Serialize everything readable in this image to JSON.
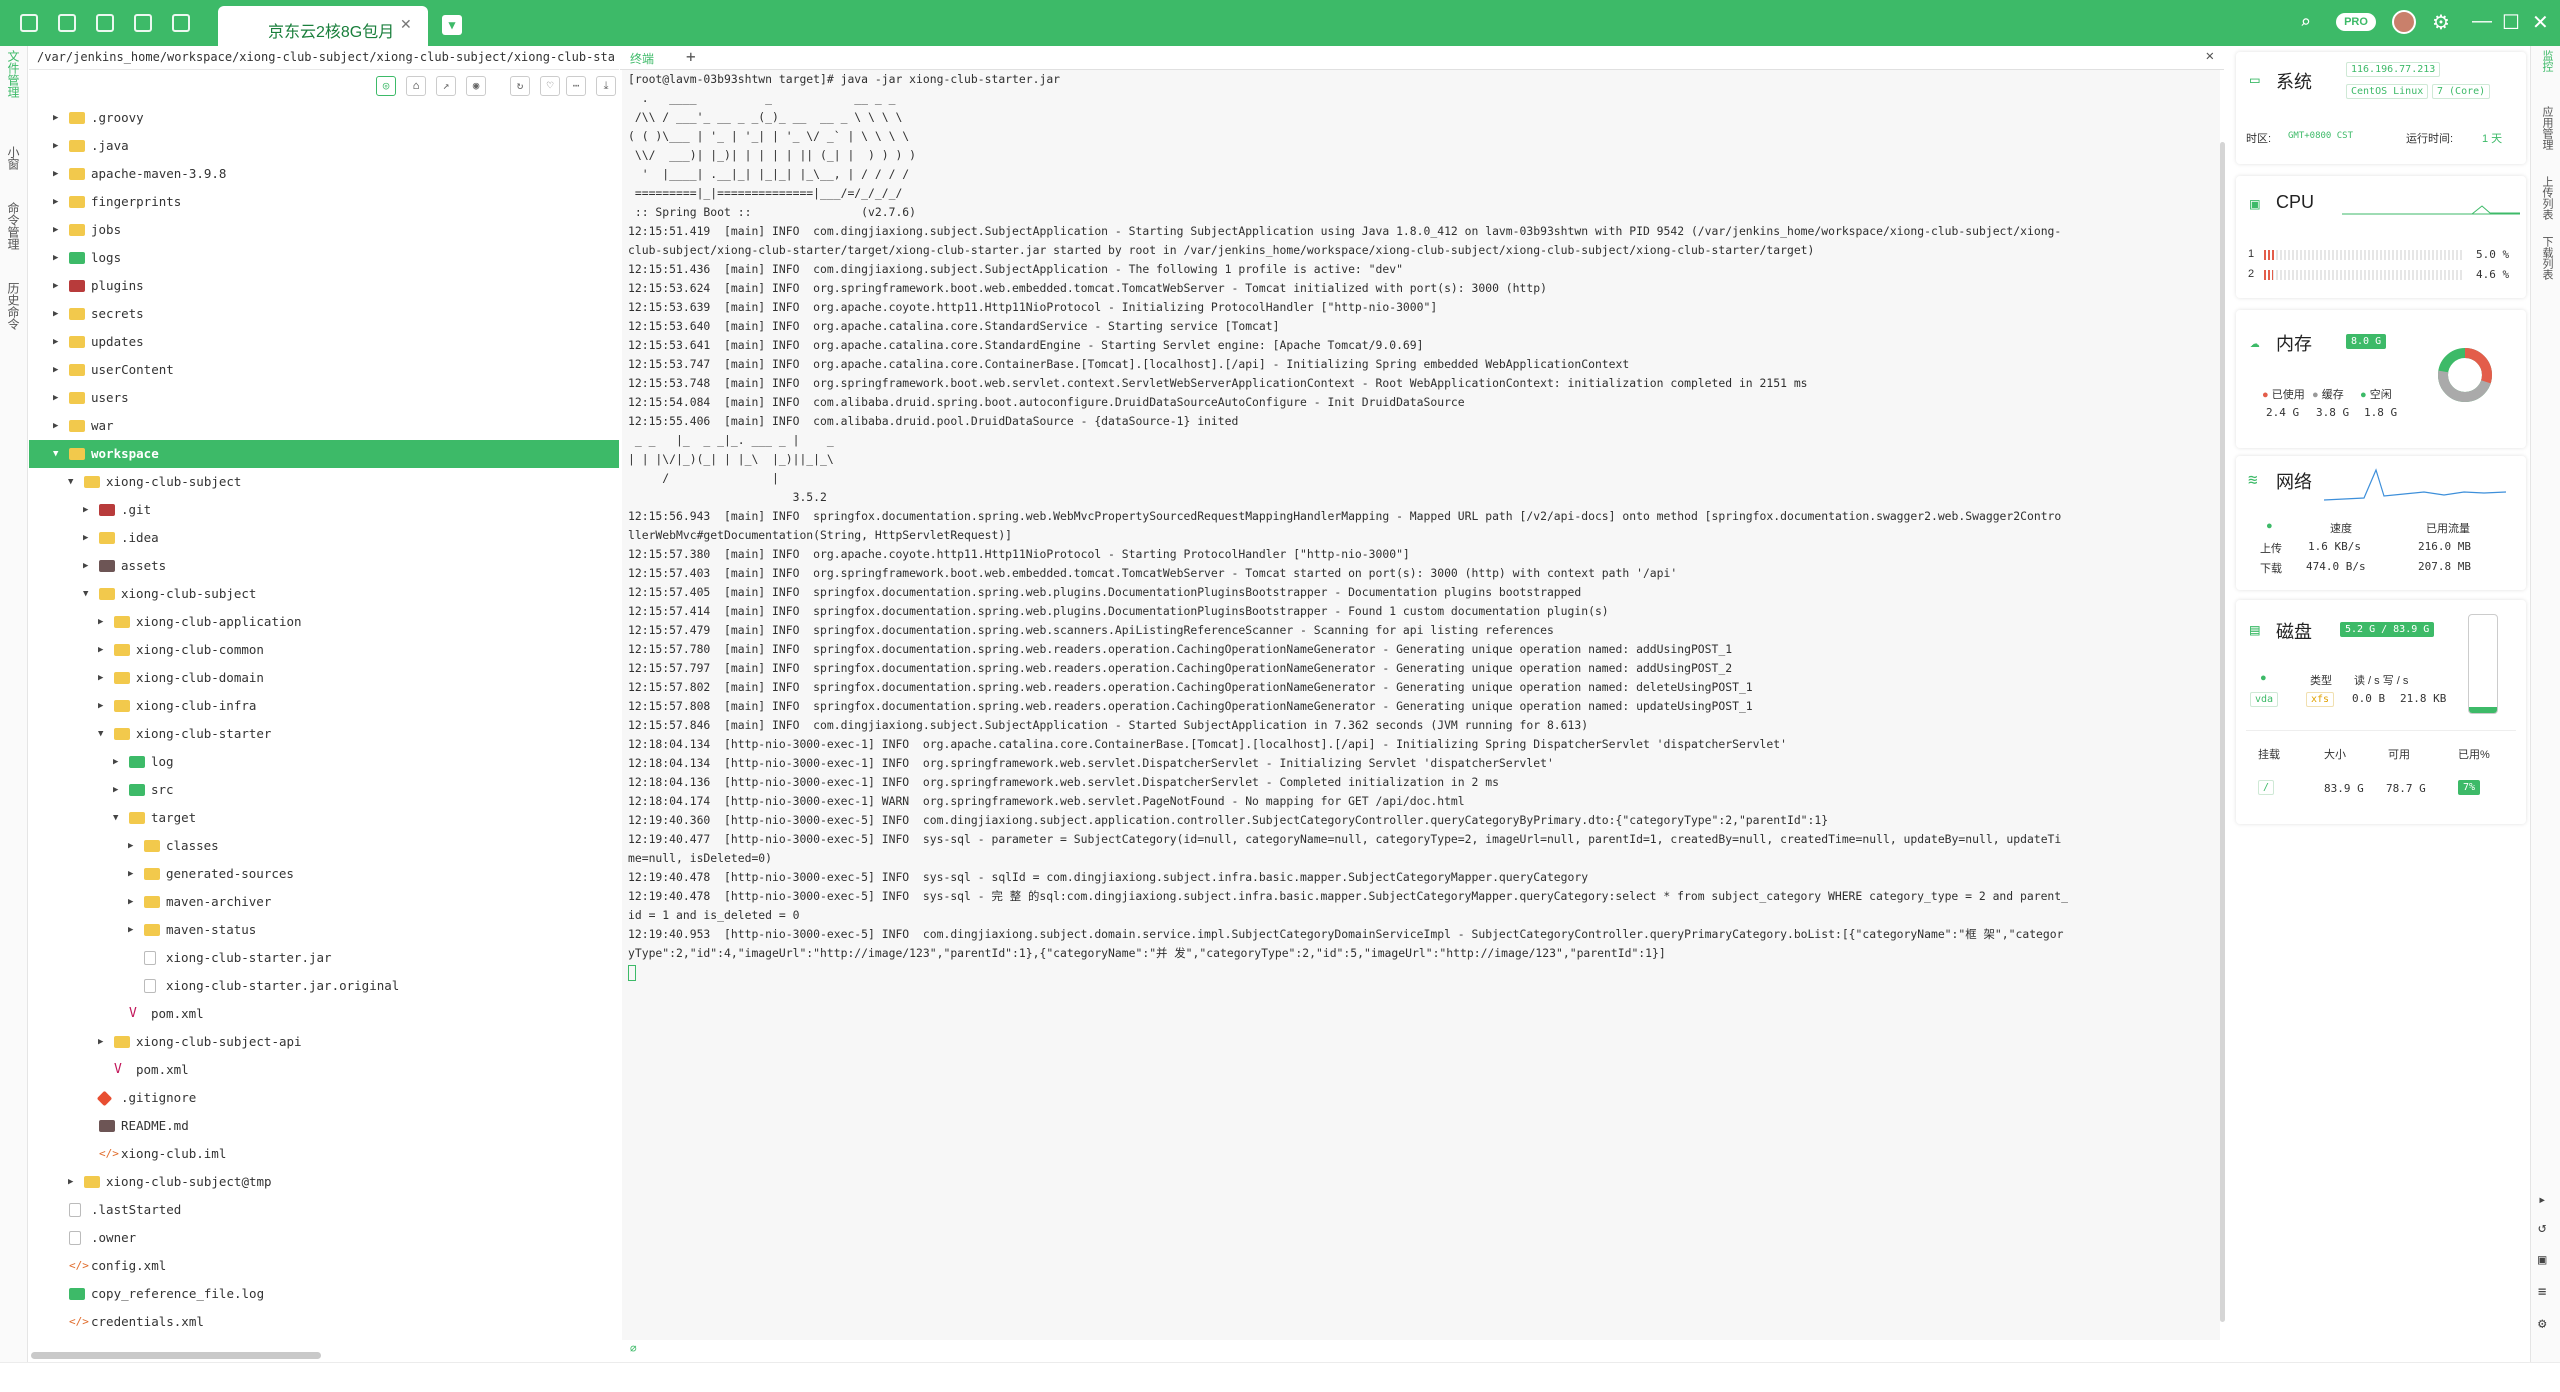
{
  "tabbar": {
    "active_tab": "京东云2核8G包月"
  },
  "leftbar": {
    "items": [
      "文件管理",
      "小窗",
      "命令管理",
      "历史命令"
    ]
  },
  "filetree": {
    "path": "/var/jenkins_home/workspace/xiong-club-subject/xiong-club-subject/xiong-club-sta",
    "rows": [
      {
        "label": ".groovy",
        "indent": 0,
        "caret": "right",
        "icon": "folder"
      },
      {
        "label": ".java",
        "indent": 0,
        "caret": "right",
        "icon": "folder"
      },
      {
        "label": "apache-maven-3.9.8",
        "indent": 0,
        "caret": "right",
        "icon": "folder"
      },
      {
        "label": "fingerprints",
        "indent": 0,
        "caret": "right",
        "icon": "folder"
      },
      {
        "label": "jobs",
        "indent": 0,
        "caret": "right",
        "icon": "folder"
      },
      {
        "label": "logs",
        "indent": 0,
        "caret": "right",
        "icon": "green"
      },
      {
        "label": "plugins",
        "indent": 0,
        "caret": "right",
        "icon": "red"
      },
      {
        "label": "secrets",
        "indent": 0,
        "caret": "right",
        "icon": "folder"
      },
      {
        "label": "updates",
        "indent": 0,
        "caret": "right",
        "icon": "folder"
      },
      {
        "label": "userContent",
        "indent": 0,
        "caret": "right",
        "icon": "folder"
      },
      {
        "label": "users",
        "indent": 0,
        "caret": "right",
        "icon": "folder"
      },
      {
        "label": "war",
        "indent": 0,
        "caret": "right",
        "icon": "folder"
      },
      {
        "label": "workspace",
        "indent": 0,
        "caret": "down",
        "icon": "folder",
        "selected": true
      },
      {
        "label": "xiong-club-subject",
        "indent": 1,
        "caret": "down",
        "icon": "folder"
      },
      {
        "label": ".git",
        "indent": 2,
        "caret": "right",
        "icon": "red"
      },
      {
        "label": ".idea",
        "indent": 2,
        "caret": "right",
        "icon": "folder"
      },
      {
        "label": "assets",
        "indent": 2,
        "caret": "right",
        "icon": "dark"
      },
      {
        "label": "xiong-club-subject",
        "indent": 2,
        "caret": "down",
        "icon": "folder"
      },
      {
        "label": "xiong-club-application",
        "indent": 3,
        "caret": "right",
        "icon": "folder"
      },
      {
        "label": "xiong-club-common",
        "indent": 3,
        "caret": "right",
        "icon": "folder"
      },
      {
        "label": "xiong-club-domain",
        "indent": 3,
        "caret": "right",
        "icon": "folder"
      },
      {
        "label": "xiong-club-infra",
        "indent": 3,
        "caret": "right",
        "icon": "folder"
      },
      {
        "label": "xiong-club-starter",
        "indent": 3,
        "caret": "down",
        "icon": "folder"
      },
      {
        "label": "log",
        "indent": 4,
        "caret": "right",
        "icon": "green"
      },
      {
        "label": "src",
        "indent": 4,
        "caret": "right",
        "icon": "green"
      },
      {
        "label": "target",
        "indent": 4,
        "caret": "down",
        "icon": "folder"
      },
      {
        "label": "classes",
        "indent": 5,
        "caret": "right",
        "icon": "folder"
      },
      {
        "label": "generated-sources",
        "indent": 5,
        "caret": "right",
        "icon": "folder"
      },
      {
        "label": "maven-archiver",
        "indent": 5,
        "caret": "right",
        "icon": "folder"
      },
      {
        "label": "maven-status",
        "indent": 5,
        "caret": "right",
        "icon": "folder"
      },
      {
        "label": "xiong-club-starter.jar",
        "indent": 5,
        "caret": "",
        "icon": "file"
      },
      {
        "label": "xiong-club-starter.jar.original",
        "indent": 5,
        "caret": "",
        "icon": "file"
      },
      {
        "label": "pom.xml",
        "indent": 4,
        "caret": "",
        "icon": "mvn"
      },
      {
        "label": "xiong-club-subject-api",
        "indent": 3,
        "caret": "right",
        "icon": "folder"
      },
      {
        "label": "pom.xml",
        "indent": 3,
        "caret": "",
        "icon": "mvn"
      },
      {
        "label": ".gitignore",
        "indent": 2,
        "caret": "",
        "icon": "git"
      },
      {
        "label": "README.md",
        "indent": 2,
        "caret": "",
        "icon": "dark"
      },
      {
        "label": "xiong-club.iml",
        "indent": 2,
        "caret": "",
        "icon": "xml"
      },
      {
        "label": "xiong-club-subject@tmp",
        "indent": 1,
        "caret": "right",
        "icon": "folder"
      },
      {
        "label": ".lastStarted",
        "indent": 0,
        "caret": "",
        "icon": "file"
      },
      {
        "label": ".owner",
        "indent": 0,
        "caret": "",
        "icon": "file"
      },
      {
        "label": "config.xml",
        "indent": 0,
        "caret": "",
        "icon": "xml"
      },
      {
        "label": "copy_reference_file.log",
        "indent": 0,
        "caret": "",
        "icon": "green"
      },
      {
        "label": "credentials.xml",
        "indent": 0,
        "caret": "",
        "icon": "xml"
      }
    ]
  },
  "terminal": {
    "tab_label": "终端",
    "lines": [
      "[root@lavm-03b93shtwn target]# java -jar xiong-club-starter.jar",
      "",
      "  .   ____          _            __ _ _",
      " /\\\\ / ___'_ __ _ _(_)_ __  __ _ \\ \\ \\ \\",
      "( ( )\\___ | '_ | '_| | '_ \\/ _` | \\ \\ \\ \\",
      " \\\\/  ___)| |_)| | | | | || (_| |  ) ) ) )",
      "  '  |____| .__|_| |_|_| |_\\__, | / / / /",
      " =========|_|==============|___/=/_/_/_/",
      " :: Spring Boot ::                (v2.7.6)",
      "",
      "12:15:51.419  [main] INFO  com.dingjiaxiong.subject.SubjectApplication - Starting SubjectApplication using Java 1.8.0_412 on lavm-03b93shtwn with PID 9542 (/var/jenkins_home/workspace/xiong-club-subject/xiong-",
      "club-subject/xiong-club-starter/target/xiong-club-starter.jar started by root in /var/jenkins_home/workspace/xiong-club-subject/xiong-club-subject/xiong-club-starter/target)",
      "12:15:51.436  [main] INFO  com.dingjiaxiong.subject.SubjectApplication - The following 1 profile is active: \"dev\"",
      "12:15:53.624  [main] INFO  org.springframework.boot.web.embedded.tomcat.TomcatWebServer - Tomcat initialized with port(s): 3000 (http)",
      "12:15:53.639  [main] INFO  org.apache.coyote.http11.Http11NioProtocol - Initializing ProtocolHandler [\"http-nio-3000\"]",
      "12:15:53.640  [main] INFO  org.apache.catalina.core.StandardService - Starting service [Tomcat]",
      "12:15:53.641  [main] INFO  org.apache.catalina.core.StandardEngine - Starting Servlet engine: [Apache Tomcat/9.0.69]",
      "12:15:53.747  [main] INFO  org.apache.catalina.core.ContainerBase.[Tomcat].[localhost].[/api] - Initializing Spring embedded WebApplicationContext",
      "12:15:53.748  [main] INFO  org.springframework.boot.web.servlet.context.ServletWebServerApplicationContext - Root WebApplicationContext: initialization completed in 2151 ms",
      "12:15:54.084  [main] INFO  com.alibaba.druid.spring.boot.autoconfigure.DruidDataSourceAutoConfigure - Init DruidDataSource",
      "12:15:55.406  [main] INFO  com.alibaba.druid.pool.DruidDataSource - {dataSource-1} inited",
      " _ _   |_  _ _|_. ___ _ |    _",
      "| | |\\/|_)(_| | |_\\  |_)||_|_\\",
      "     /               |",
      "                        3.5.2",
      "12:15:56.943  [main] INFO  springfox.documentation.spring.web.WebMvcPropertySourcedRequestMappingHandlerMapping - Mapped URL path [/v2/api-docs] onto method [springfox.documentation.swagger2.web.Swagger2Contro",
      "llerWebMvc#getDocumentation(String, HttpServletRequest)]",
      "12:15:57.380  [main] INFO  org.apache.coyote.http11.Http11NioProtocol - Starting ProtocolHandler [\"http-nio-3000\"]",
      "12:15:57.403  [main] INFO  org.springframework.boot.web.embedded.tomcat.TomcatWebServer - Tomcat started on port(s): 3000 (http) with context path '/api'",
      "12:15:57.405  [main] INFO  springfox.documentation.spring.web.plugins.DocumentationPluginsBootstrapper - Documentation plugins bootstrapped",
      "12:15:57.414  [main] INFO  springfox.documentation.spring.web.plugins.DocumentationPluginsBootstrapper - Found 1 custom documentation plugin(s)",
      "12:15:57.479  [main] INFO  springfox.documentation.spring.web.scanners.ApiListingReferenceScanner - Scanning for api listing references",
      "12:15:57.780  [main] INFO  springfox.documentation.spring.web.readers.operation.CachingOperationNameGenerator - Generating unique operation named: addUsingPOST_1",
      "12:15:57.797  [main] INFO  springfox.documentation.spring.web.readers.operation.CachingOperationNameGenerator - Generating unique operation named: addUsingPOST_2",
      "12:15:57.802  [main] INFO  springfox.documentation.spring.web.readers.operation.CachingOperationNameGenerator - Generating unique operation named: deleteUsingPOST_1",
      "12:15:57.808  [main] INFO  springfox.documentation.spring.web.readers.operation.CachingOperationNameGenerator - Generating unique operation named: updateUsingPOST_1",
      "12:15:57.846  [main] INFO  com.dingjiaxiong.subject.SubjectApplication - Started SubjectApplication in 7.362 seconds (JVM running for 8.613)",
      "12:18:04.134  [http-nio-3000-exec-1] INFO  org.apache.catalina.core.ContainerBase.[Tomcat].[localhost].[/api] - Initializing Spring DispatcherServlet 'dispatcherServlet'",
      "12:18:04.134  [http-nio-3000-exec-1] INFO  org.springframework.web.servlet.DispatcherServlet - Initializing Servlet 'dispatcherServlet'",
      "12:18:04.136  [http-nio-3000-exec-1] INFO  org.springframework.web.servlet.DispatcherServlet - Completed initialization in 2 ms",
      "12:18:04.174  [http-nio-3000-exec-1] WARN  org.springframework.web.servlet.PageNotFound - No mapping for GET /api/doc.html",
      "12:19:40.360  [http-nio-3000-exec-5] INFO  com.dingjiaxiong.subject.application.controller.SubjectCategoryController.queryCategoryByPrimary.dto:{\"categoryType\":2,\"parentId\":1}",
      "12:19:40.477  [http-nio-3000-exec-5] INFO  sys-sql - parameter = SubjectCategory(id=null, categoryName=null, categoryType=2, imageUrl=null, parentId=1, createdBy=null, createdTime=null, updateBy=null, updateTi",
      "me=null, isDeleted=0)",
      "12:19:40.478  [http-nio-3000-exec-5] INFO  sys-sql - sqlId = com.dingjiaxiong.subject.infra.basic.mapper.SubjectCategoryMapper.queryCategory",
      "12:19:40.478  [http-nio-3000-exec-5] INFO  sys-sql - 完 整 的sql:com.dingjiaxiong.subject.infra.basic.mapper.SubjectCategoryMapper.queryCategory:select * from subject_category WHERE category_type = 2 and parent_",
      "id = 1 and is_deleted = 0",
      "12:19:40.953  [http-nio-3000-exec-5] INFO  com.dingjiaxiong.subject.domain.service.impl.SubjectCategoryDomainServiceImpl - SubjectCategoryController.queryPrimaryCategory.boList:[{\"categoryName\":\"框 架\",\"categor",
      "yType\":2,\"id\":4,\"imageUrl\":\"http://image/123\",\"parentId\":1},{\"categoryName\":\"并 发\",\"categoryType\":2,\"id\":5,\"imageUrl\":\"http://image/123\",\"parentId\":1}]"
    ]
  },
  "monitor": {
    "system": {
      "title": "系统",
      "ip": "116.196.77.213",
      "os": "CentOS Linux",
      "version": "7 (Core)",
      "tz_label": "时区:",
      "tz_value": "GMT+0800  CST",
      "uptime_label": "运行时间:",
      "uptime_value": "1 天"
    },
    "cpu": {
      "title": "CPU",
      "cores": [
        {
          "id": "1",
          "percent": 5.0,
          "text": "5.0 %"
        },
        {
          "id": "2",
          "percent": 4.6,
          "text": "4.6 %"
        }
      ]
    },
    "memory": {
      "title": "内存",
      "total": "8.0 G",
      "used_label": "已使用",
      "cache_label": "缓存",
      "free_label": "空闲",
      "used": "2.4 G",
      "cache": "3.8 G",
      "free": "1.8 G",
      "used_frac": 0.3,
      "cache_frac": 0.475
    },
    "network": {
      "title": "网络",
      "speed_label": "速度",
      "traffic_label": "已用流量",
      "up_label": "上传",
      "down_label": "下载",
      "up_speed": "1.6 KB/s",
      "down_speed": "474.0 B/s",
      "up_total": "216.0 MB",
      "down_total": "207.8 MB"
    },
    "disk": {
      "title": "磁盘",
      "summary": "5.2 G / 83.9 G",
      "type_label": "类型",
      "rw_label": "读 / s 写 / s",
      "dev": "vda",
      "fs": "xfs",
      "read": "0.0 B",
      "write": "21.8 KB",
      "fill_frac": 0.062,
      "mount_label": "挂载",
      "size_label": "大小",
      "avail_label": "可用",
      "used_label": "已用%",
      "mount": "/",
      "size": "83.9 G",
      "avail": "78.7 G",
      "used_pct": "7%"
    }
  },
  "rightbar": {
    "items": [
      "监控",
      "应用管理",
      "上传列表",
      "下载列表"
    ]
  },
  "colors": {
    "accent": "#3dba68",
    "warn": "#e35d4a"
  }
}
